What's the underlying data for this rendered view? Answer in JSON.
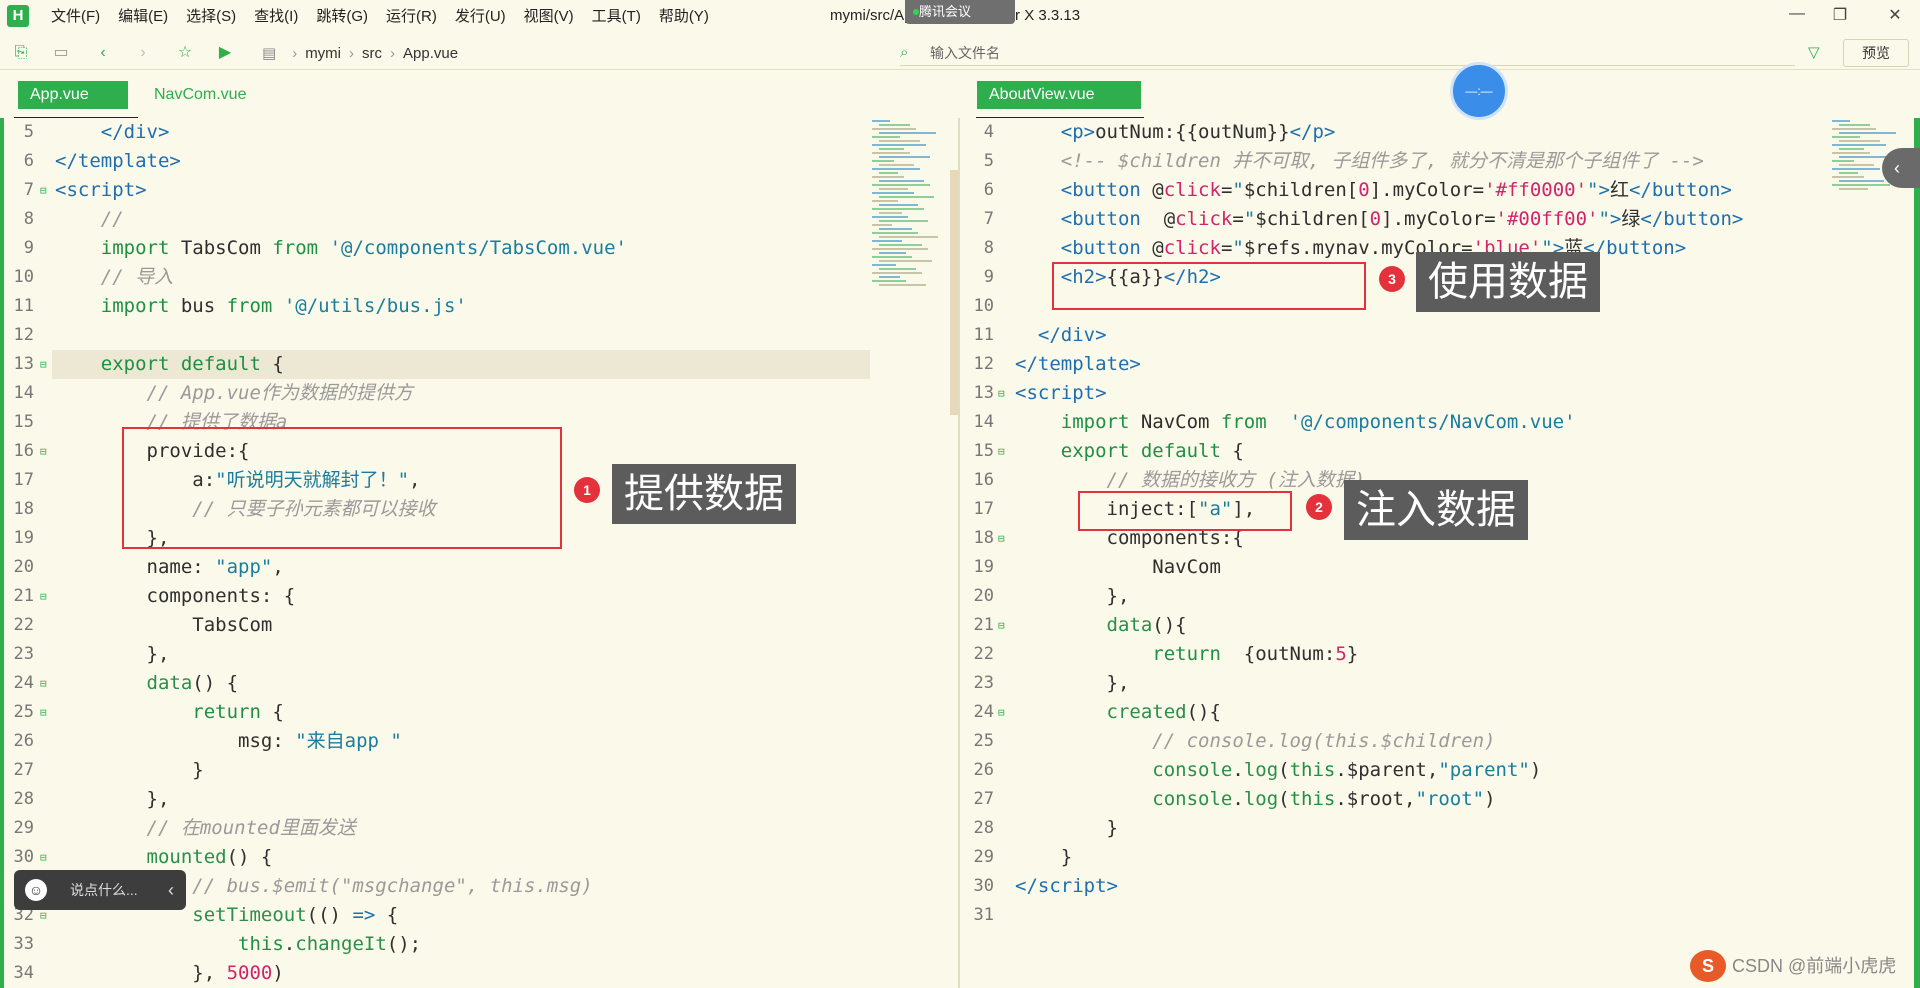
{
  "menu": [
    "文件(F)",
    "编辑(E)",
    "选择(S)",
    "查找(I)",
    "跳转(G)",
    "运行(R)",
    "发行(U)",
    "视图(V)",
    "工具(T)",
    "帮助(Y)"
  ],
  "window_title": "mymi/src/App.vue - HBuilder X 3.3.13",
  "meeting_badge": "腾讯会议",
  "breadcrumb": [
    "mymi",
    "src",
    "App.vue"
  ],
  "file_input_placeholder": "输入文件名",
  "preview_button": "预览",
  "left_tabs": [
    {
      "label": "App.vue",
      "active": true
    },
    {
      "label": "NavCom.vue",
      "active": false
    }
  ],
  "right_tabs": [
    {
      "label": "AboutView.vue",
      "active": true
    }
  ],
  "left_code": [
    {
      "n": "5",
      "fold": false,
      "html": "    <span class=\"t\">&lt;/div&gt;</span>"
    },
    {
      "n": "6",
      "fold": false,
      "html": "<span class=\"t\">&lt;/template&gt;</span>"
    },
    {
      "n": "7",
      "fold": true,
      "html": "<span class=\"t\">&lt;script&gt;</span>"
    },
    {
      "n": "8",
      "fold": false,
      "html": "    <span class=\"c\">//</span>"
    },
    {
      "n": "9",
      "fold": false,
      "html": "    <span class=\"k\">import</span> TabsCom <span class=\"k\">from</span> <span class=\"s\">'@/components/TabsCom.vue'</span>"
    },
    {
      "n": "10",
      "fold": false,
      "html": "    <span class=\"c\">// 导入</span>"
    },
    {
      "n": "11",
      "fold": false,
      "html": "    <span class=\"k\">import</span> bus <span class=\"k\">from</span> <span class=\"s\">'@/utils/bus.js'</span>"
    },
    {
      "n": "12",
      "fold": false,
      "html": ""
    },
    {
      "n": "13",
      "fold": true,
      "hl": true,
      "html": "    <span class=\"k\">export</span> <span class=\"k\">default</span> {"
    },
    {
      "n": "14",
      "fold": false,
      "html": "        <span class=\"c\">// App.vue作为数据的提供方</span>"
    },
    {
      "n": "15",
      "fold": false,
      "html": "        <span class=\"c\">// 提供了数据a</span>"
    },
    {
      "n": "16",
      "fold": true,
      "html": "        provide:{"
    },
    {
      "n": "17",
      "fold": false,
      "html": "            a:<span class=\"s\">\"听说明天就解封了！\"</span>,"
    },
    {
      "n": "18",
      "fold": false,
      "html": "            <span class=\"c\">// 只要子孙元素都可以接收</span>"
    },
    {
      "n": "19",
      "fold": false,
      "html": "        },"
    },
    {
      "n": "20",
      "fold": false,
      "html": "        name: <span class=\"s\">\"app\"</span>,"
    },
    {
      "n": "21",
      "fold": true,
      "html": "        components: {"
    },
    {
      "n": "22",
      "fold": false,
      "html": "            TabsCom"
    },
    {
      "n": "23",
      "fold": false,
      "html": "        },"
    },
    {
      "n": "24",
      "fold": true,
      "html": "        <span class=\"f\">data</span>() {"
    },
    {
      "n": "25",
      "fold": true,
      "html": "            <span class=\"k\">return</span> {"
    },
    {
      "n": "26",
      "fold": false,
      "html": "                msg: <span class=\"s\">\"来自app \"</span>"
    },
    {
      "n": "27",
      "fold": false,
      "html": "            }"
    },
    {
      "n": "28",
      "fold": false,
      "html": "        },"
    },
    {
      "n": "29",
      "fold": false,
      "html": "        <span class=\"c\">// 在mounted里面发送</span>"
    },
    {
      "n": "30",
      "fold": true,
      "html": "        <span class=\"f\">mounted</span>() {"
    },
    {
      "n": "31",
      "fold": false,
      "html": "            <span class=\"c\">// bus.$emit(\"msgchange\", this.msg)</span>"
    },
    {
      "n": "32",
      "fold": true,
      "html": "            <span class=\"f\">setTimeout</span>(() <span class=\"t\">=&gt;</span> {"
    },
    {
      "n": "33",
      "fold": false,
      "html": "                <span class=\"k\">this</span>.<span class=\"f\">changeIt</span>();"
    },
    {
      "n": "34",
      "fold": false,
      "html": "            }, <span class=\"n\">5000</span>)"
    }
  ],
  "right_code": [
    {
      "n": "4",
      "fold": false,
      "html": "    <span class=\"t\">&lt;p&gt;</span>outNum:{{outNum}}<span class=\"t\">&lt;/p&gt;</span>"
    },
    {
      "n": "5",
      "fold": false,
      "html": "    <span class=\"c\">&lt;!-- $children 并不可取, 子组件多了, 就分不清是那个子组件了 --&gt;</span>"
    },
    {
      "n": "6",
      "fold": false,
      "html": "    <span class=\"t\">&lt;button</span> @<span class=\"n\">click</span>=<span class=\"s\">\"</span>$children[<span class=\"n\">0</span>].myColor=<span class=\"n\">'#ff0000'</span><span class=\"s\">\"</span><span class=\"t\">&gt;</span>红<span class=\"t\">&lt;/button&gt;</span>"
    },
    {
      "n": "7",
      "fold": false,
      "html": "    <span class=\"t\">&lt;button</span>  @<span class=\"n\">click</span>=<span class=\"s\">\"</span>$children[<span class=\"n\">0</span>].myColor=<span class=\"n\">'#00ff00'</span><span class=\"s\">\"</span><span class=\"t\">&gt;</span>绿<span class=\"t\">&lt;/button&gt;</span>"
    },
    {
      "n": "8",
      "fold": false,
      "html": "    <span class=\"t\">&lt;button</span> @<span class=\"n\">click</span>=<span class=\"s\">\"</span>$refs.mynav.myColor=<span class=\"n\">'blue'</span><span class=\"s\">\"</span><span class=\"t\">&gt;</span>蓝<span class=\"t\">&lt;/button&gt;</span>"
    },
    {
      "n": "9",
      "fold": false,
      "html": "    <span class=\"t\">&lt;h2&gt;</span>{{a}}<span class=\"t\">&lt;/h2&gt;</span>"
    },
    {
      "n": "10",
      "fold": false,
      "html": ""
    },
    {
      "n": "11",
      "fold": false,
      "html": "  <span class=\"t\">&lt;/div&gt;</span>"
    },
    {
      "n": "12",
      "fold": false,
      "html": "<span class=\"t\">&lt;/template&gt;</span>"
    },
    {
      "n": "13",
      "fold": true,
      "html": "<span class=\"t\">&lt;script&gt;</span>"
    },
    {
      "n": "14",
      "fold": false,
      "html": "    <span class=\"k\">import</span> NavCom <span class=\"k\">from</span>  <span class=\"s\">'@/components/NavCom.vue'</span>"
    },
    {
      "n": "15",
      "fold": true,
      "html": "    <span class=\"k\">export</span> <span class=\"k\">default</span> {"
    },
    {
      "n": "16",
      "fold": false,
      "html": "        <span class=\"c\">// 数据的接收方 (注入数据)</span>"
    },
    {
      "n": "17",
      "fold": false,
      "html": "        inject:[<span class=\"s\">\"a\"</span>],"
    },
    {
      "n": "18",
      "fold": true,
      "html": "        components:{"
    },
    {
      "n": "19",
      "fold": false,
      "html": "            NavCom"
    },
    {
      "n": "20",
      "fold": false,
      "html": "        },"
    },
    {
      "n": "21",
      "fold": true,
      "html": "        <span class=\"f\">data</span>(){"
    },
    {
      "n": "22",
      "fold": false,
      "html": "            <span class=\"k\">return</span>  {outNum:<span class=\"n\">5</span>}"
    },
    {
      "n": "23",
      "fold": false,
      "html": "        },"
    },
    {
      "n": "24",
      "fold": true,
      "html": "        <span class=\"f\">created</span>(){"
    },
    {
      "n": "25",
      "fold": false,
      "html": "            <span class=\"c\">// console.log(this.$children)</span>"
    },
    {
      "n": "26",
      "fold": false,
      "html": "            <span class=\"f\">console</span>.<span class=\"f\">log</span>(<span class=\"k\">this</span>.$parent,<span class=\"s\">\"parent\"</span>)"
    },
    {
      "n": "27",
      "fold": false,
      "html": "            <span class=\"f\">console</span>.<span class=\"f\">log</span>(<span class=\"k\">this</span>.$root,<span class=\"s\">\"root\"</span>)"
    },
    {
      "n": "28",
      "fold": false,
      "html": "        }"
    },
    {
      "n": "29",
      "fold": false,
      "html": "    }"
    },
    {
      "n": "30",
      "fold": false,
      "html": "<span class=\"t\">&lt;/script&gt;</span>"
    },
    {
      "n": "31",
      "fold": false,
      "html": ""
    }
  ],
  "annotations": {
    "one": {
      "num": "1",
      "label": "提供数据"
    },
    "two": {
      "num": "2",
      "label": "注入数据"
    },
    "three": {
      "num": "3",
      "label": "使用数据"
    }
  },
  "chat": {
    "placeholder": "说点什么..."
  },
  "watermark": "CSDN @前端小虎虎",
  "colors": {
    "accent": "#2fae4e",
    "annotation_red": "#e3323c",
    "editor_bg": "#fbf9e9"
  }
}
